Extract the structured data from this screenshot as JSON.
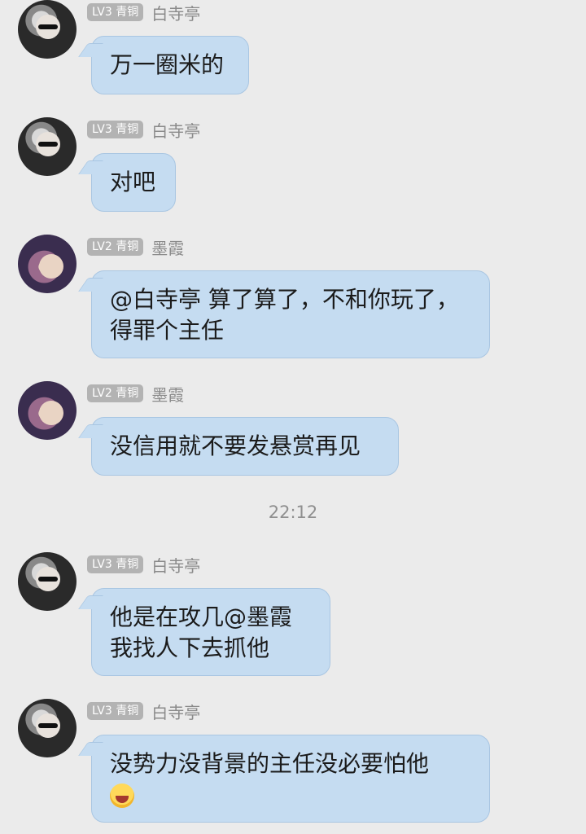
{
  "messages": [
    {
      "level": "LV3 青铜",
      "name": "白寺亭",
      "lines": [
        "万一圈米的"
      ],
      "avatar": "user-avatar-baisiting"
    },
    {
      "level": "LV3 青铜",
      "name": "白寺亭",
      "lines": [
        "对吧"
      ],
      "avatar": "user-avatar-baisiting"
    },
    {
      "level": "LV2 青铜",
      "name": "墨霞",
      "lines": [
        "@白寺亭 算了算了，不和你玩了，",
        "得罪个主任"
      ],
      "avatar": "user-avatar-moxia"
    },
    {
      "level": "LV2 青铜",
      "name": "墨霞",
      "lines": [
        "没信用就不要发悬赏再见"
      ],
      "avatar": "user-avatar-moxia"
    },
    {
      "level": "LV3 青铜",
      "name": "白寺亭",
      "lines": [
        "他是在攻几@墨霞",
        "我找人下去抓他"
      ],
      "avatar": "user-avatar-baisiting"
    },
    {
      "level": "LV3 青铜",
      "name": "白寺亭",
      "lines": [
        "没势力没背景的主任没必要怕他"
      ],
      "emoji": "grinning-sweat-emoji",
      "avatar": "user-avatar-baisiting"
    }
  ],
  "timestamp": "22:12"
}
